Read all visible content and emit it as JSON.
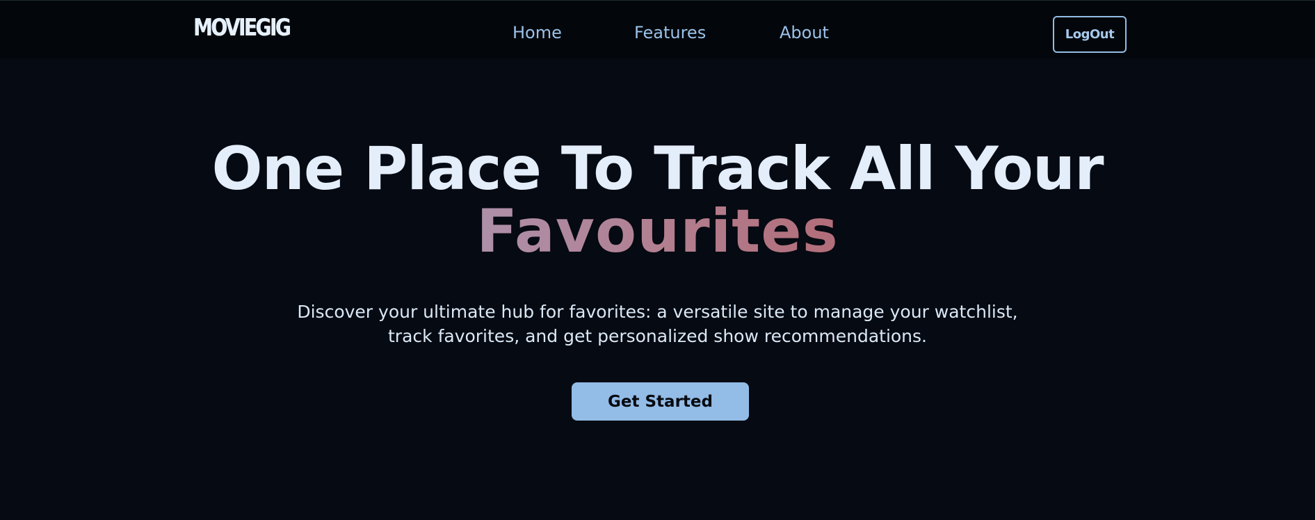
{
  "navbar": {
    "logo": "MOVIEGIG",
    "links": [
      "Home",
      "Features",
      "About"
    ],
    "logout_label": "LogOut"
  },
  "hero": {
    "title_line1": "One Place To Track All Your",
    "title_line2": "Favourites",
    "subtitle_line1": "Discover your ultimate hub for favorites: a versatile site to manage your watchlist,",
    "subtitle_line2": "track favorites, and get personalized show recommendations.",
    "cta_label": "Get Started"
  },
  "colors": {
    "background": "#060a12",
    "navbar_background": "#03070b",
    "accent": "#93bce6",
    "title_text": "#e4eefb",
    "gradient_start": "#ad90aa",
    "gradient_end": "#b26d79"
  }
}
